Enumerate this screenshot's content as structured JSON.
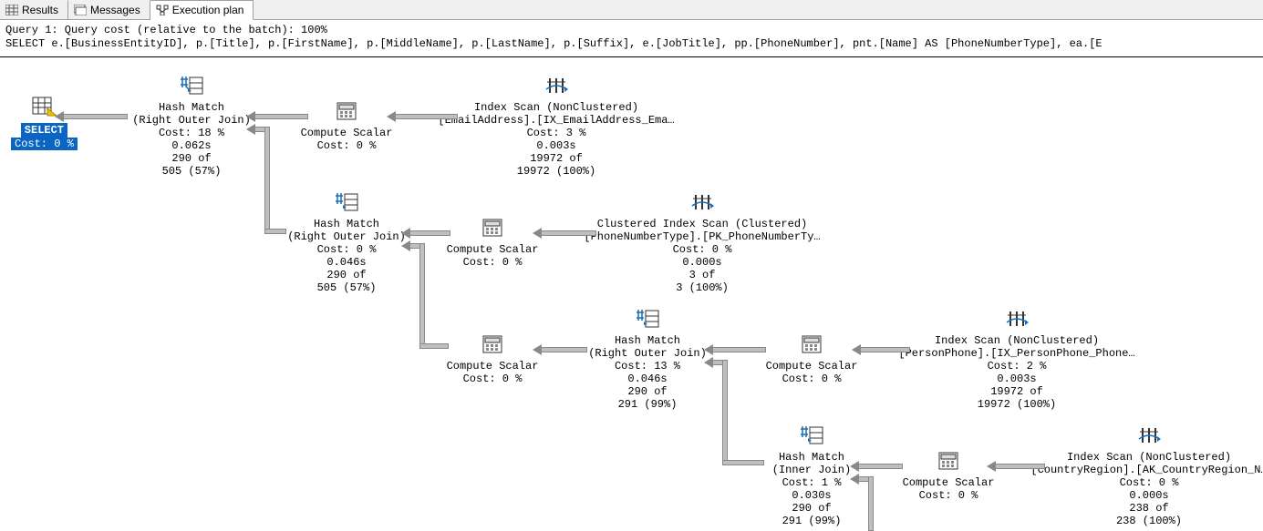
{
  "tabs": {
    "results": "Results",
    "messages": "Messages",
    "execution_plan": "Execution plan"
  },
  "header": {
    "line1": "Query 1: Query cost (relative to the batch): 100%",
    "line2": "SELECT e.[BusinessEntityID], p.[Title], p.[FirstName], p.[MiddleName], p.[LastName], p.[Suffix], e.[JobTitle], pp.[PhoneNumber], pnt.[Name] AS [PhoneNumberType], ea.[E"
  },
  "ops": {
    "select": {
      "label": "SELECT",
      "cost": "Cost: 0 %"
    },
    "hash1": {
      "title": "Hash Match",
      "sub": "(Right Outer Join)",
      "l1": "Cost: 18 %",
      "l2": "0.062s",
      "l3": "290 of",
      "l4": "505 (57%)"
    },
    "cs1": {
      "title": "Compute Scalar",
      "l1": "Cost: 0 %"
    },
    "is1": {
      "title": "Index Scan (NonClustered)",
      "sub": "[EmailAddress].[IX_EmailAddress_Ema…",
      "l1": "Cost: 3 %",
      "l2": "0.003s",
      "l3": "19972 of",
      "l4": "19972 (100%)"
    },
    "hash2": {
      "title": "Hash Match",
      "sub": "(Right Outer Join)",
      "l1": "Cost: 0 %",
      "l2": "0.046s",
      "l3": "290 of",
      "l4": "505 (57%)"
    },
    "cs2": {
      "title": "Compute Scalar",
      "l1": "Cost: 0 %"
    },
    "cis": {
      "title": "Clustered Index Scan (Clustered)",
      "sub": "[PhoneNumberType].[PK_PhoneNumberTy…",
      "l1": "Cost: 0 %",
      "l2": "0.000s",
      "l3": "3 of",
      "l4": "3 (100%)"
    },
    "cs3": {
      "title": "Compute Scalar",
      "l1": "Cost: 0 %"
    },
    "hash3": {
      "title": "Hash Match",
      "sub": "(Right Outer Join)",
      "l1": "Cost: 13 %",
      "l2": "0.046s",
      "l3": "290 of",
      "l4": "291 (99%)"
    },
    "cs4": {
      "title": "Compute Scalar",
      "l1": "Cost: 0 %"
    },
    "is2": {
      "title": "Index Scan (NonClustered)",
      "sub": "[PersonPhone].[IX_PersonPhone_Phone…",
      "l1": "Cost: 2 %",
      "l2": "0.003s",
      "l3": "19972 of",
      "l4": "19972 (100%)"
    },
    "hash4": {
      "title": "Hash Match",
      "sub": "(Inner Join)",
      "l1": "Cost: 1 %",
      "l2": "0.030s",
      "l3": "290 of",
      "l4": "291 (99%)"
    },
    "cs5": {
      "title": "Compute Scalar",
      "l1": "Cost: 0 %"
    },
    "is3": {
      "title": "Index Scan (NonClustered)",
      "sub": "[CountryRegion].[AK_CountryRegion_N…",
      "l1": "Cost: 0 %",
      "l2": "0.000s",
      "l3": "238 of",
      "l4": "238 (100%)"
    }
  }
}
